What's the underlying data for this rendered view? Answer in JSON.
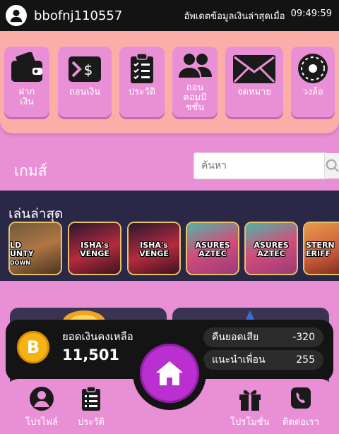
{
  "header": {
    "username": "bbofnj110557",
    "update_label": "อัพเดตข้อมูลเงินล่าสุดเมื่อ",
    "update_time": "09:49:59"
  },
  "quick_menu": [
    {
      "label": "ฝาก\nเงิน",
      "icon": "wallet-icon"
    },
    {
      "label": "ถอนเงิน",
      "icon": "withdraw-icon"
    },
    {
      "label": "ประวัติ",
      "icon": "clipboard-icon"
    },
    {
      "label": "ถอน\nคอมมิ\nชชั่น",
      "icon": "users-icon"
    },
    {
      "label": "จดหมาย",
      "icon": "mail-icon"
    },
    {
      "label": "วงล้อ",
      "icon": "wheel-icon"
    }
  ],
  "games": {
    "title": "เกมส์",
    "search_placeholder": "ค้นหา"
  },
  "recent": {
    "title": "เล่นล่าสุด",
    "thumbs": [
      "LD\nUNTY\nDOWN",
      "ISHA's\nVENGE",
      "ISHA's\nVENGE",
      "ASURES\nAZTEC",
      "ASURES\nAZTEC",
      "STERN\nERIFF"
    ]
  },
  "wallet": {
    "balance_label": "ยอดเงินคงเหลือ",
    "balance_value": "11,501",
    "cashback_label": "คืนยอดเสีย",
    "cashback_value": "-320",
    "referral_label": "แนะนำเพื่อน",
    "referral_value": "255",
    "coin_symbol": "B"
  },
  "nav": {
    "profile": "โปรไฟล์",
    "history": "ประวัติ",
    "promotion": "โปรโมชั่น",
    "contact": "ติดต่อเรา"
  },
  "colors": {
    "topbar": "#131313",
    "quickmenu_bg": "#fbada8",
    "pink": "#e98fd6",
    "recent_bg": "#2b2746",
    "home": "#b92fd0"
  }
}
